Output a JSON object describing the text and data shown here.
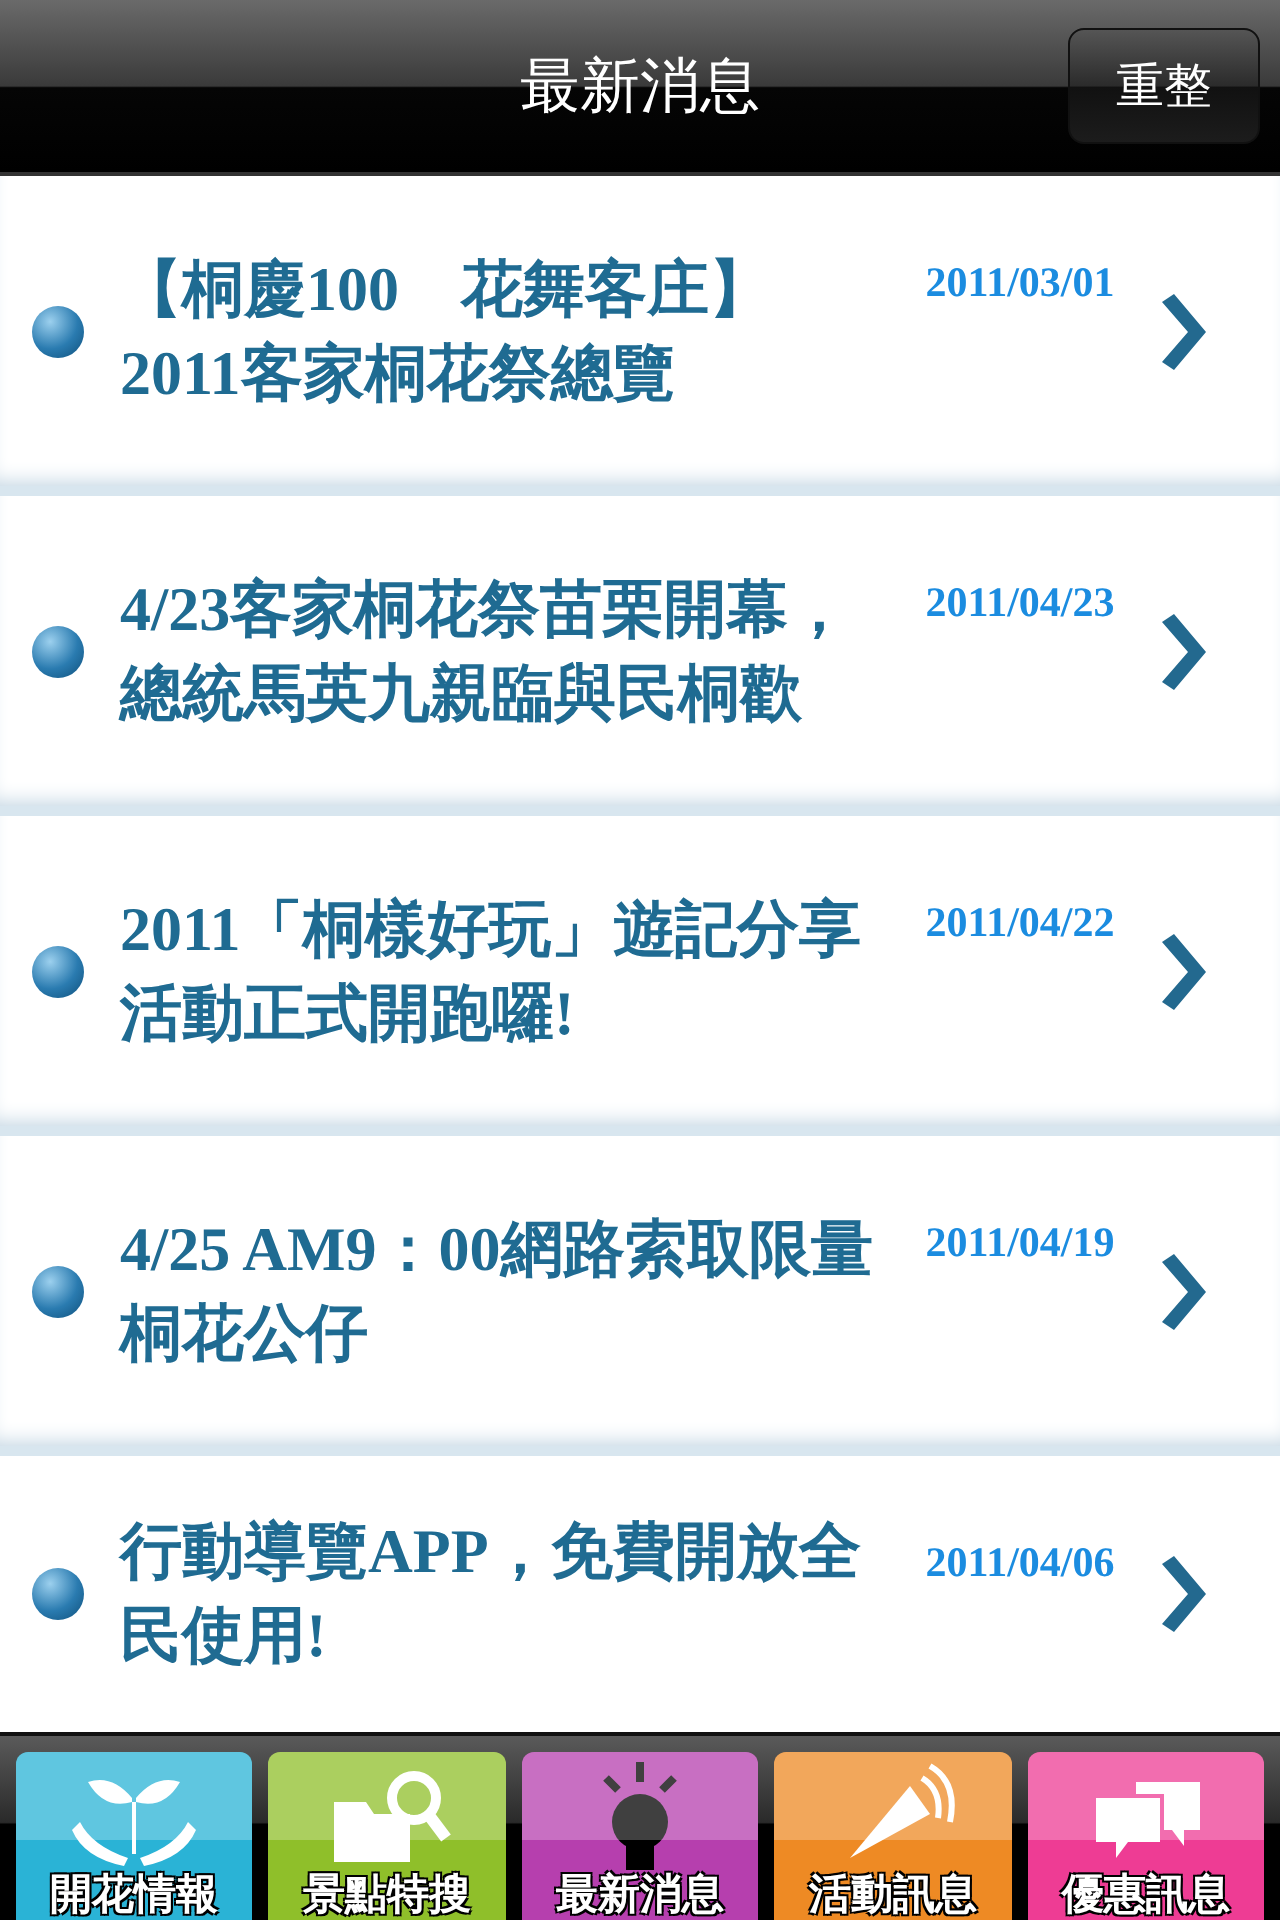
{
  "header": {
    "title": "最新消息",
    "button": "重整"
  },
  "news": [
    {
      "title": "【桐慶100　花舞客庄】2011客家桐花祭總覽",
      "date": "2011/03/01"
    },
    {
      "title": "4/23客家桐花祭苗栗開幕，總統馬英九親臨與民桐歡",
      "date": "2011/04/23"
    },
    {
      "title": "2011「桐樣好玩」遊記分享活動正式開跑囉!",
      "date": "2011/04/22"
    },
    {
      "title": "4/25 AM9：00網路索取限量桐花公仔",
      "date": "2011/04/19"
    },
    {
      "title": "行動導覽APP，免費開放全民使用!",
      "date": "2011/04/06"
    }
  ],
  "tabs": [
    {
      "label": "開花情報",
      "kind": "sprout",
      "color": "#2ab3d6",
      "selected": false
    },
    {
      "label": "景點特搜",
      "kind": "search",
      "color": "#8fbf2a",
      "selected": false
    },
    {
      "label": "最新消息",
      "kind": "bulb",
      "color": "#b63fae",
      "selected": true
    },
    {
      "label": "活動訊息",
      "kind": "megaphone",
      "color": "#ee8a24",
      "selected": false
    },
    {
      "label": "優惠訊息",
      "kind": "chat",
      "color": "#ee3c94",
      "selected": false
    }
  ]
}
